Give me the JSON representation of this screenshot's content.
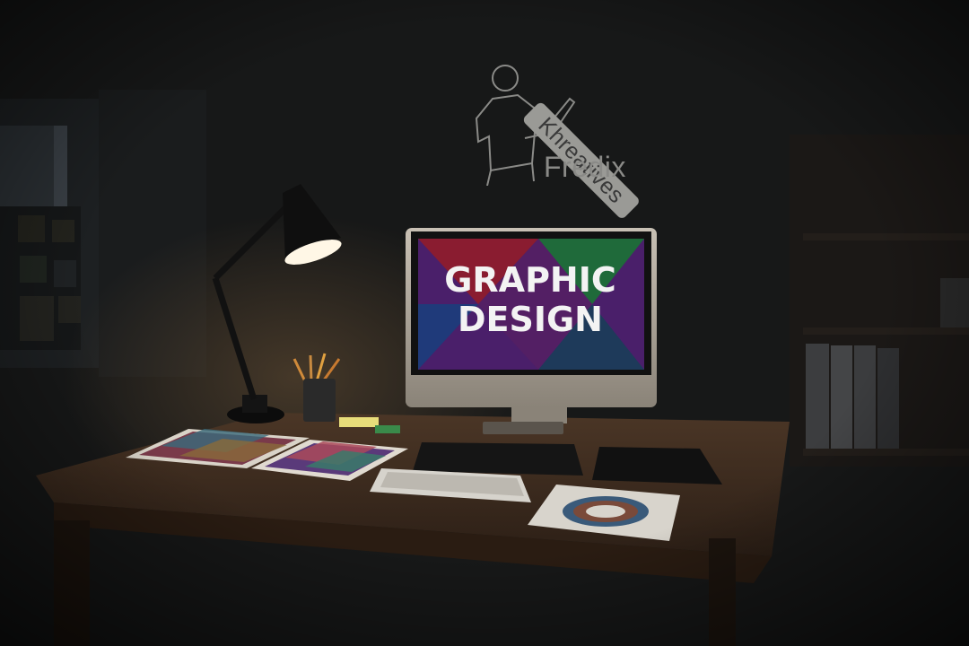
{
  "logo": {
    "tag_text": "Khreatives",
    "name_text": "Fredix"
  },
  "monitor": {
    "line1": "GRAPHIC",
    "line2": "DESIGN"
  },
  "colors": {
    "wall": "#141515",
    "desk": "#4a3424",
    "lamp_light": "#fff7e6",
    "screen_red": "#8a1c30",
    "screen_green": "#1f6a3a",
    "screen_blue": "#1f3a7a",
    "screen_purple": "#4a1f6a"
  }
}
